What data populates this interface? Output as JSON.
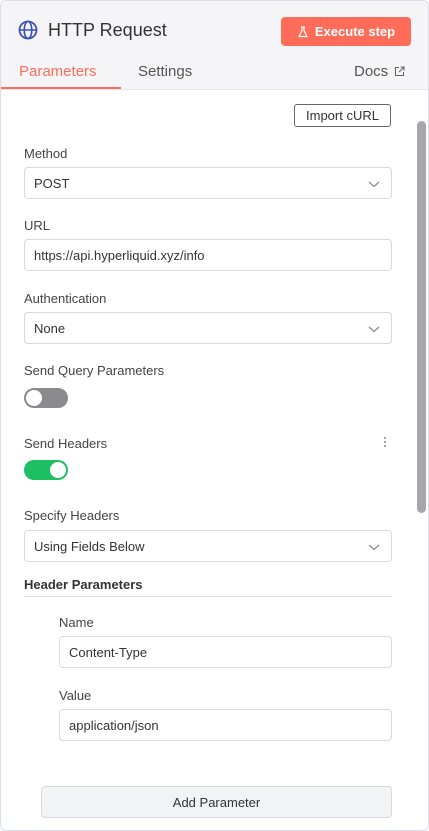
{
  "header": {
    "title": "HTTP Request",
    "execute_label": "Execute step",
    "node_icon": "globe-icon",
    "accent": "#ff6d5a"
  },
  "tabs": [
    {
      "label": "Parameters",
      "active": true
    },
    {
      "label": "Settings",
      "active": false
    },
    {
      "label": "Docs",
      "active": false,
      "icon": "external-link-icon"
    }
  ],
  "toolbar": {
    "import_label": "Import cURL"
  },
  "form": {
    "method": {
      "label": "Method",
      "value": "POST"
    },
    "url": {
      "label": "URL",
      "value": "https://api.hyperliquid.xyz/info"
    },
    "authentication": {
      "label": "Authentication",
      "value": "None"
    },
    "send_query": {
      "label": "Send Query Parameters",
      "enabled": false
    },
    "send_headers": {
      "label": "Send Headers",
      "enabled": true
    },
    "specify_headers": {
      "label": "Specify Headers",
      "value": "Using Fields Below"
    },
    "header_params": {
      "title": "Header Parameters",
      "name_label": "Name",
      "name_value": "Content-Type",
      "value_label": "Value",
      "value_value": "application/json"
    },
    "add_param_label": "Add Parameter"
  },
  "colors": {
    "toggle_on": "#1ebe63",
    "toggle_off": "#8a8a8f"
  }
}
